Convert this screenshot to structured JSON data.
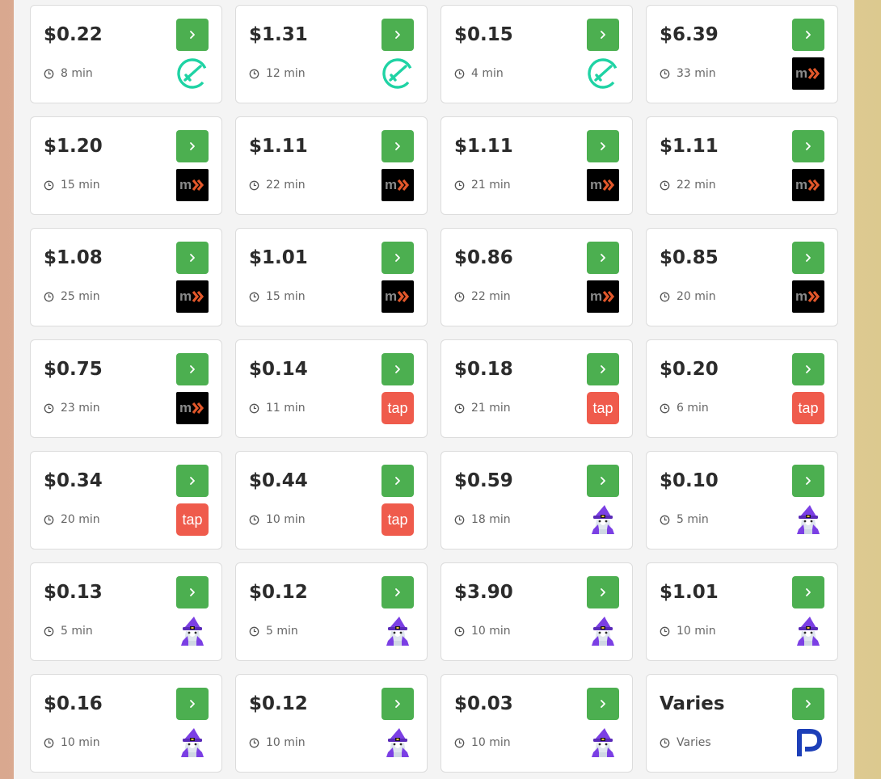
{
  "colors": {
    "button_green": "#4caf50",
    "price_text": "#2b2b2b",
    "muted_text": "#666666",
    "check_teal": "#1fd3a4",
    "mx_black": "#000000",
    "mx_orange": "#e2572a",
    "tap_red": "#ef5b4c",
    "wizard_purple": "#7b3fe4",
    "p_blue": "#1d3fb8"
  },
  "offers": [
    {
      "price": "$0.22",
      "time": "8 min",
      "provider": "check"
    },
    {
      "price": "$1.31",
      "time": "12 min",
      "provider": "check"
    },
    {
      "price": "$0.15",
      "time": "4 min",
      "provider": "check"
    },
    {
      "price": "$6.39",
      "time": "33 min",
      "provider": "mx"
    },
    {
      "price": "$1.20",
      "time": "15 min",
      "provider": "mx"
    },
    {
      "price": "$1.11",
      "time": "22 min",
      "provider": "mx"
    },
    {
      "price": "$1.11",
      "time": "21 min",
      "provider": "mx"
    },
    {
      "price": "$1.11",
      "time": "22 min",
      "provider": "mx"
    },
    {
      "price": "$1.08",
      "time": "25 min",
      "provider": "mx"
    },
    {
      "price": "$1.01",
      "time": "15 min",
      "provider": "mx"
    },
    {
      "price": "$0.86",
      "time": "22 min",
      "provider": "mx"
    },
    {
      "price": "$0.85",
      "time": "20 min",
      "provider": "mx"
    },
    {
      "price": "$0.75",
      "time": "23 min",
      "provider": "mx"
    },
    {
      "price": "$0.14",
      "time": "11 min",
      "provider": "tap"
    },
    {
      "price": "$0.18",
      "time": "21 min",
      "provider": "tap"
    },
    {
      "price": "$0.20",
      "time": "6 min",
      "provider": "tap"
    },
    {
      "price": "$0.34",
      "time": "20 min",
      "provider": "tap"
    },
    {
      "price": "$0.44",
      "time": "10 min",
      "provider": "tap"
    },
    {
      "price": "$0.59",
      "time": "18 min",
      "provider": "wizard"
    },
    {
      "price": "$0.10",
      "time": "5 min",
      "provider": "wizard"
    },
    {
      "price": "$0.13",
      "time": "5 min",
      "provider": "wizard"
    },
    {
      "price": "$0.12",
      "time": "5 min",
      "provider": "wizard"
    },
    {
      "price": "$3.90",
      "time": "10 min",
      "provider": "wizard"
    },
    {
      "price": "$1.01",
      "time": "10 min",
      "provider": "wizard"
    },
    {
      "price": "$0.16",
      "time": "10 min",
      "provider": "wizard"
    },
    {
      "price": "$0.12",
      "time": "10 min",
      "provider": "wizard"
    },
    {
      "price": "$0.03",
      "time": "10 min",
      "provider": "wizard"
    },
    {
      "price": "Varies",
      "time": "Varies",
      "provider": "p"
    }
  ],
  "logo_text": {
    "mx": "mx",
    "tap": "tap"
  }
}
